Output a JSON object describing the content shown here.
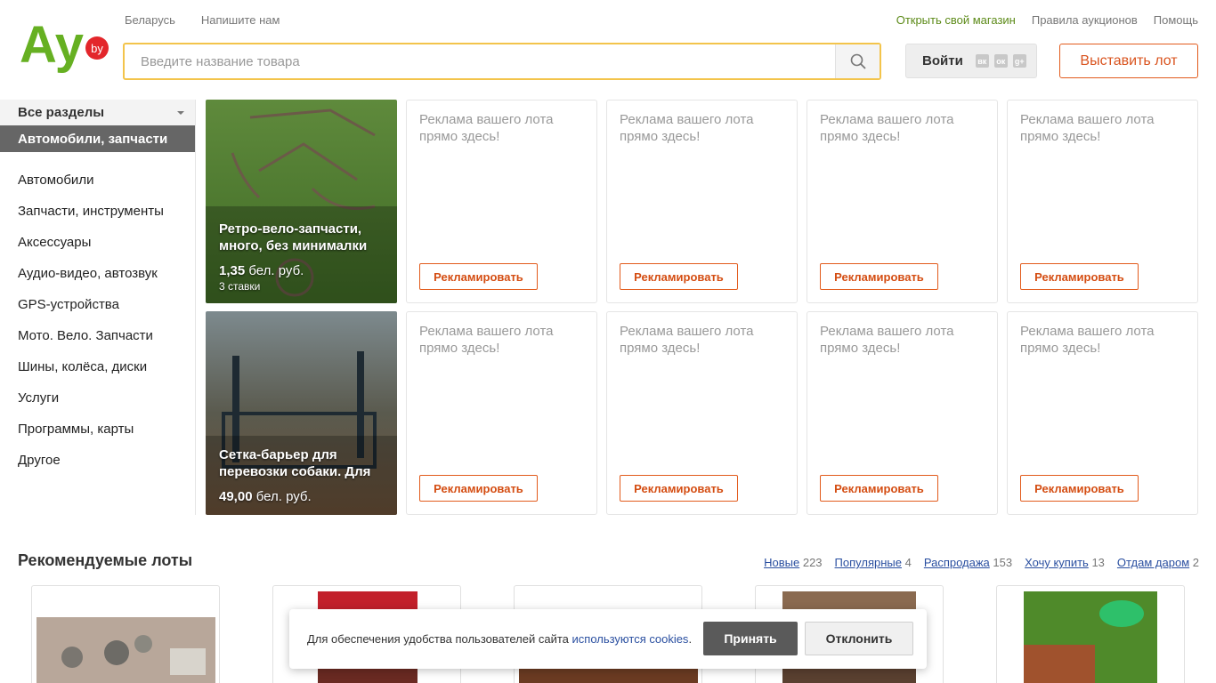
{
  "logo": {
    "main": "Ay",
    "badge": "by"
  },
  "header": {
    "links_left": [
      "Беларусь",
      "Напишите нам"
    ],
    "links_right": [
      "Открыть свой магазин",
      "Правила аукционов",
      "Помощь"
    ],
    "search_placeholder": "Введите название товара",
    "login_label": "Войти",
    "social_icons": [
      "vk-icon",
      "odnoklassniki-icon",
      "mailru-icon",
      "google-plus-icon"
    ],
    "sell_label": "Выставить лот"
  },
  "sidebar": {
    "all_sections": "Все разделы",
    "active": "Автомобили, запчасти",
    "items": [
      "Автомобили",
      "Запчасти, инструменты",
      "Аксессуары",
      "Аудио-видео, автозвук",
      "GPS-устройства",
      "Мото. Вело. Запчасти",
      "Шины, колёса, диски",
      "Услуги",
      "Программы, карты",
      "Другое"
    ]
  },
  "lots": [
    {
      "title": "Ретро-вело-запчасти, много, без минималки",
      "price": "1,35",
      "currency": "бел. руб.",
      "bids": "3 ставки"
    },
    {
      "title": "Сетка-барьер для перевозки собаки. Для",
      "price": "49,00",
      "currency": "бел. руб."
    }
  ],
  "ad": {
    "text": "Реклама вашего лота прямо здесь!",
    "button": "Рекламировать"
  },
  "recommended": {
    "title": "Рекомендуемые лоты",
    "tabs": [
      {
        "label": "Новые",
        "count": "223"
      },
      {
        "label": "Популярные",
        "count": "4"
      },
      {
        "label": "Распродажа",
        "count": "153"
      },
      {
        "label": "Хочу купить",
        "count": "13"
      },
      {
        "label": "Отдам даром",
        "count": "2"
      }
    ]
  },
  "cookie": {
    "text": "Для обеспечения удобства пользователей сайта ",
    "link": "используются cookies",
    "after": ".",
    "accept": "Принять",
    "decline": "Отклонить"
  },
  "colors": {
    "brand_green": "#66b022",
    "brand_red": "#e3262b",
    "accent_orange": "#d9531e",
    "search_border": "#f3c44b"
  }
}
